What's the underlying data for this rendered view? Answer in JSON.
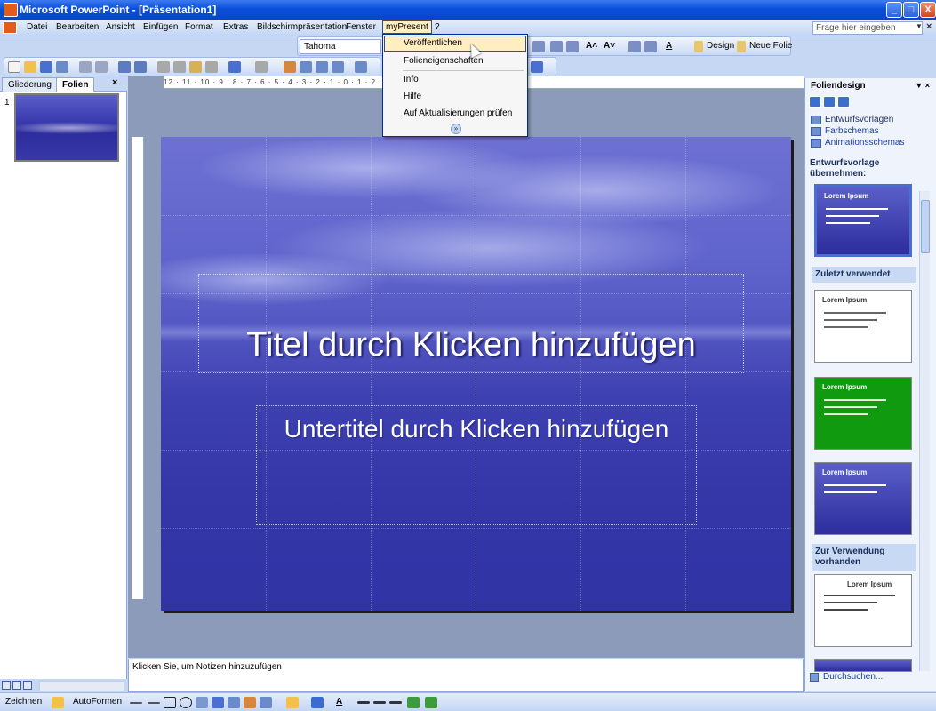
{
  "window": {
    "title": "Microsoft PowerPoint - [Präsentation1]",
    "buttons": {
      "minimize": "_",
      "maximize": "□",
      "close": "X"
    }
  },
  "menubar": {
    "items": [
      "Datei",
      "Bearbeiten",
      "Ansicht",
      "Einfügen",
      "Format",
      "Extras",
      "Bildschirmpräsentation",
      "Fenster",
      "myPresent",
      "?"
    ],
    "help_placeholder": "Frage hier eingeben",
    "close_glyph": "×"
  },
  "toolbar": {
    "font_name": "Tahoma",
    "design_label": "Design",
    "new_slide_label": "Neue Folie",
    "font_color_glyph": "A"
  },
  "dropdown": {
    "items": [
      "Veröffentlichen",
      "Folieneigenschaften",
      "Info",
      "Hilfe",
      "Auf Aktualisierungen prüfen"
    ],
    "highlighted_index": 0,
    "expand_glyph": "»"
  },
  "leftpane": {
    "tabs": [
      "Gliederung",
      "Folien"
    ],
    "active_tab": "Folien",
    "slide_number": "1",
    "close_glyph": "×"
  },
  "slide": {
    "title_placeholder": "Titel durch Klicken hinzufügen",
    "subtitle_placeholder": "Untertitel durch Klicken hinzufügen",
    "hruler_text": "12 · 11 · 10 · 9 · 8 · 7 · 6 · 5 · 4 · 3 · 2 · 1 · 0 · 1 · 2 · 3 · 4 · 5 · 6 · 7 · 8 · 9 · 10 · 11 · 12"
  },
  "notes": {
    "placeholder": "Klicken Sie, um Notizen hinzuzufügen"
  },
  "taskpane": {
    "title": "Foliendesign",
    "header_arrows": "▼ ×",
    "links": [
      "Entwurfsvorlagen",
      "Farbschemas",
      "Animationsschemas"
    ],
    "section_apply": "Entwurfsvorlage übernehmen:",
    "section_recent": "Zuletzt verwendet",
    "section_available": "Zur Verwendung vorhanden",
    "thumb_title": "Lorem Ipsum",
    "footer_link": "Durchsuchen..."
  },
  "drawbar": {
    "draw_label": "Zeichnen",
    "autoshapes_label": "AutoFormen"
  },
  "colors": {
    "titlebar": "#0a4fd8",
    "menu_highlight": "#ffeec2",
    "slide_blue": "#4e53be",
    "taskpane_bg": "#eef3fc"
  }
}
